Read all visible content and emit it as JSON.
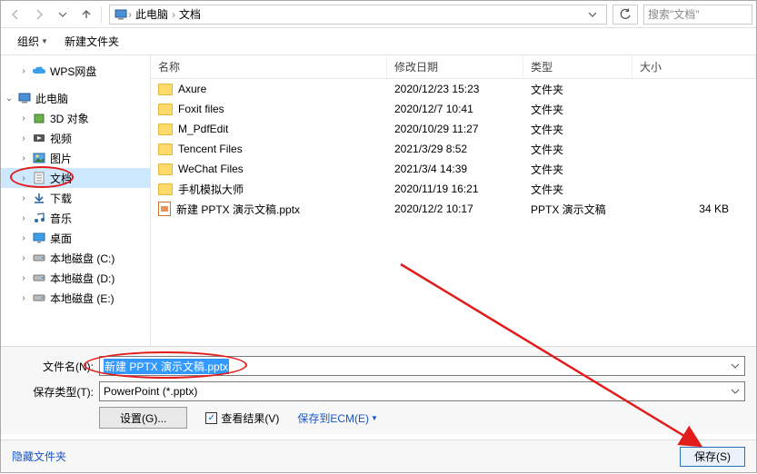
{
  "nav": {
    "crumbs": [
      "此电脑",
      "文档"
    ],
    "search_placeholder": "搜索\"文档\""
  },
  "toolbar": {
    "organize": "组织",
    "new_folder": "新建文件夹"
  },
  "sidebar": {
    "wps": "WPS网盘",
    "this_pc": "此电脑",
    "items": [
      {
        "label": "3D 对象",
        "icon": "cube"
      },
      {
        "label": "视频",
        "icon": "video"
      },
      {
        "label": "图片",
        "icon": "image"
      },
      {
        "label": "文档",
        "icon": "doc",
        "selected": true
      },
      {
        "label": "下载",
        "icon": "download"
      },
      {
        "label": "音乐",
        "icon": "music"
      },
      {
        "label": "桌面",
        "icon": "desktop"
      },
      {
        "label": "本地磁盘 (C:)",
        "icon": "drive"
      },
      {
        "label": "本地磁盘 (D:)",
        "icon": "drive"
      },
      {
        "label": "本地磁盘 (E:)",
        "icon": "drive"
      }
    ]
  },
  "columns": {
    "name": "名称",
    "date": "修改日期",
    "type": "类型",
    "size": "大小"
  },
  "rows": [
    {
      "name": "Axure",
      "date": "2020/12/23 15:23",
      "type": "文件夹",
      "size": "",
      "icon": "folder"
    },
    {
      "name": "Foxit files",
      "date": "2020/12/7 10:41",
      "type": "文件夹",
      "size": "",
      "icon": "folder"
    },
    {
      "name": "M_PdfEdit",
      "date": "2020/10/29 11:27",
      "type": "文件夹",
      "size": "",
      "icon": "folder"
    },
    {
      "name": "Tencent Files",
      "date": "2021/3/29 8:52",
      "type": "文件夹",
      "size": "",
      "icon": "folder"
    },
    {
      "name": "WeChat Files",
      "date": "2021/3/4 14:39",
      "type": "文件夹",
      "size": "",
      "icon": "folder"
    },
    {
      "name": "手机模拟大师",
      "date": "2020/11/19 16:21",
      "type": "文件夹",
      "size": "",
      "icon": "folder"
    },
    {
      "name": "新建 PPTX 演示文稿.pptx",
      "date": "2020/12/2 10:17",
      "type": "PPTX 演示文稿",
      "size": "34 KB",
      "icon": "pptx"
    }
  ],
  "form": {
    "filename_label": "文件名(N):",
    "filename_value": "新建 PPTX 演示文稿.pptx",
    "filetype_label": "保存类型(T):",
    "filetype_value": "PowerPoint (*.pptx)",
    "settings_btn": "设置(G)...",
    "preview_chk": "查看结果(V)",
    "ecm_link": "保存到ECM(E)"
  },
  "footer": {
    "hide_folders": "隐藏文件夹",
    "save": "保存(S)"
  }
}
